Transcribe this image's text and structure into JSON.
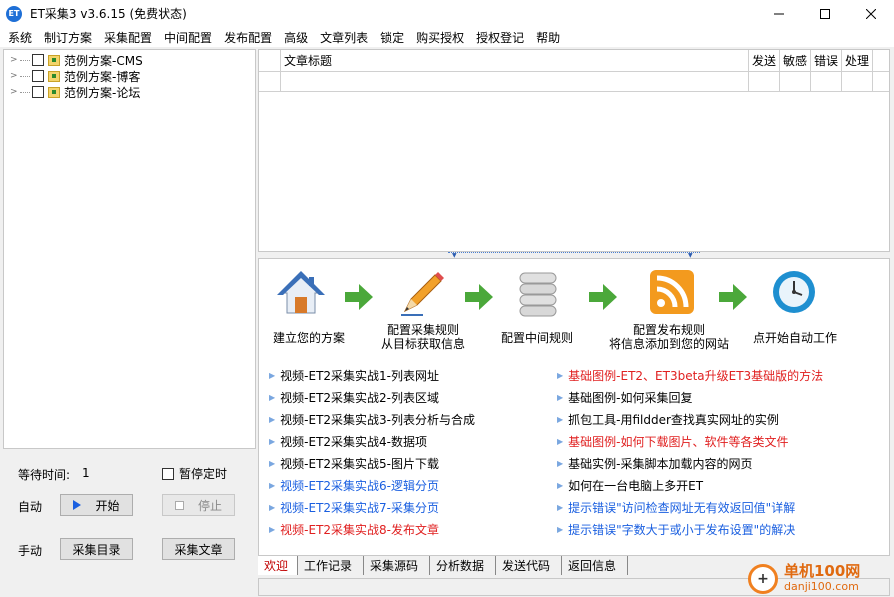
{
  "app": {
    "icon_text": "ET",
    "title": "ET采集3 v3.6.15 (免费状态)"
  },
  "menu": [
    "系统",
    "制订方案",
    "采集配置",
    "中间配置",
    "发布配置",
    "高级",
    "文章列表",
    "锁定",
    "购买授权",
    "授权登记",
    "帮助"
  ],
  "tree": {
    "items": [
      {
        "label": "范例方案-CMS"
      },
      {
        "label": "范例方案-博客"
      },
      {
        "label": "范例方案-论坛"
      }
    ]
  },
  "controls": {
    "wait_label": "等待时间:",
    "wait_value": "1",
    "pause_label": "暂停定时",
    "auto_label": "自动",
    "start_label": "开始",
    "stop_label": "停止",
    "manual_label": "手动",
    "collect_dir_label": "采集目录",
    "collect_article_label": "采集文章"
  },
  "table": {
    "columns": [
      "文章标题",
      "发送",
      "敏感",
      "错误",
      "处理"
    ]
  },
  "steps": [
    {
      "label": "建立您的方案",
      "icon": "home-icon"
    },
    {
      "label_line1": "配置采集规则",
      "label_line2": "从目标获取信息",
      "icon": "pencil-icon"
    },
    {
      "label": "配置中间规则",
      "icon": "database-icon"
    },
    {
      "label_line1": "配置发布规则",
      "label_line2": "将信息添加到您的网站",
      "icon": "rss-icon"
    },
    {
      "label": "点开始自动工作",
      "icon": "clock-icon"
    }
  ],
  "links_left": [
    {
      "text": "视频-ET2采集实战1-列表网址",
      "color": "#000000"
    },
    {
      "text": "视频-ET2采集实战2-列表区域",
      "color": "#000000"
    },
    {
      "text": "视频-ET2采集实战3-列表分析与合成",
      "color": "#000000"
    },
    {
      "text": "视频-ET2采集实战4-数据项",
      "color": "#000000"
    },
    {
      "text": "视频-ET2采集实战5-图片下载",
      "color": "#000000"
    },
    {
      "text": "视频-ET2采集实战6-逻辑分页",
      "color": "#1a5fe0"
    },
    {
      "text": "视频-ET2采集实战7-采集分页",
      "color": "#1a5fe0"
    },
    {
      "text": "视频-ET2采集实战8-发布文章",
      "color": "#e02020"
    }
  ],
  "links_right": [
    {
      "text": "基础图例-ET2、ET3beta升级ET3基础版的方法",
      "color": "#e02020"
    },
    {
      "text": "基础图例-如何采集回复",
      "color": "#000000"
    },
    {
      "text": "抓包工具-用fildder查找真实网址的实例",
      "color": "#000000"
    },
    {
      "text": "基础图例-如何下载图片、软件等各类文件",
      "color": "#e02020"
    },
    {
      "text": "基础实例-采集脚本加载内容的网页",
      "color": "#000000"
    },
    {
      "text": "如何在一台电脑上多开ET",
      "color": "#000000"
    },
    {
      "text": "提示错误\"访问检查网址无有效返回值\"详解",
      "color": "#1a5fe0"
    },
    {
      "text": "提示错误\"字数大于或小于发布设置\"的解决",
      "color": "#1a5fe0"
    }
  ],
  "tabs": [
    "欢迎",
    "工作记录",
    "采集源码",
    "分析数据",
    "发送代码",
    "返回信息"
  ],
  "watermark": {
    "line1": "单机100网",
    "line2": "danji100.com"
  }
}
